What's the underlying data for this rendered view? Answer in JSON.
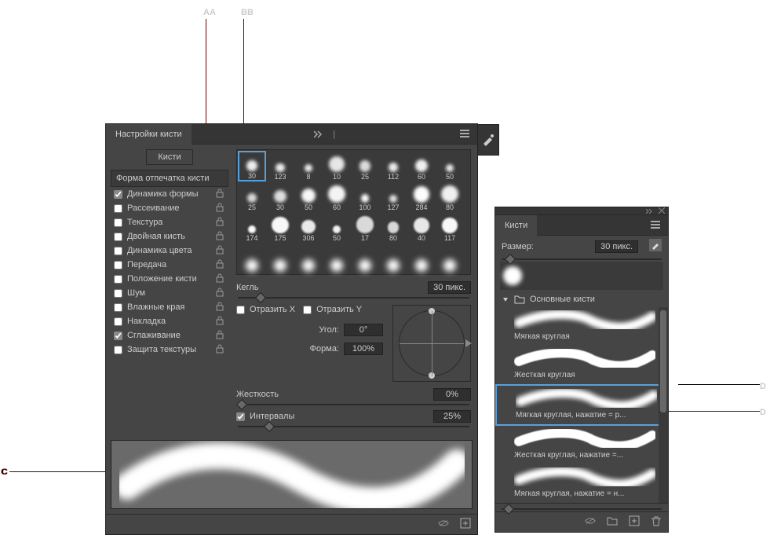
{
  "markers": {
    "A": "A",
    "B": "B",
    "C": "C",
    "D": "D"
  },
  "brush_settings": {
    "title": "Настройки кисти",
    "brushes_button": "Кисти",
    "tip_shape_button": "Форма отпечатка кисти",
    "options": [
      {
        "label": "Динамика формы",
        "checked": true,
        "locked": true
      },
      {
        "label": "Рассеивание",
        "checked": false,
        "locked": true
      },
      {
        "label": "Текстура",
        "checked": false,
        "locked": true
      },
      {
        "label": "Двойная кисть",
        "checked": false,
        "locked": true
      },
      {
        "label": "Динамика цвета",
        "checked": false,
        "locked": true
      },
      {
        "label": "Передача",
        "checked": false,
        "locked": true
      },
      {
        "label": "Положение кисти",
        "checked": false,
        "locked": true
      },
      {
        "label": "Шум",
        "checked": false,
        "locked": true
      },
      {
        "label": "Влажные края",
        "checked": false,
        "locked": true
      },
      {
        "label": "Накладка",
        "checked": false,
        "locked": true
      },
      {
        "label": "Сглаживание",
        "checked": true,
        "locked": true
      },
      {
        "label": "Защита текстуры",
        "checked": false,
        "locked": true
      }
    ],
    "thumbnails_row1": [
      30,
      123,
      8,
      10,
      25,
      112,
      60,
      50
    ],
    "thumbnails_row2": [
      25,
      30,
      50,
      60,
      100,
      127,
      284,
      80
    ],
    "thumbnails_row3": [
      174,
      175,
      306,
      50,
      17,
      80,
      40,
      117
    ],
    "size_label": "Кегль",
    "size_value": "30 пикс.",
    "flip_x": "Отразить X",
    "flip_y": "Отразить Y",
    "angle_label": "Угол:",
    "angle_value": "0°",
    "roundness_label": "Форма:",
    "roundness_value": "100%",
    "hardness_label": "Жесткость",
    "hardness_value": "0%",
    "spacing_label": "Интервалы",
    "spacing_value": "25%"
  },
  "brushes_panel": {
    "title": "Кисти",
    "size_label": "Размер:",
    "size_value": "30 пикс.",
    "folder_label": "Основные кисти",
    "brushes": [
      "Мягкая круглая",
      "Жесткая круглая",
      "Мягкая круглая, нажатие = р...",
      "Жесткая круглая, нажатие =...",
      "Мягкая круглая, нажатие = н..."
    ]
  }
}
